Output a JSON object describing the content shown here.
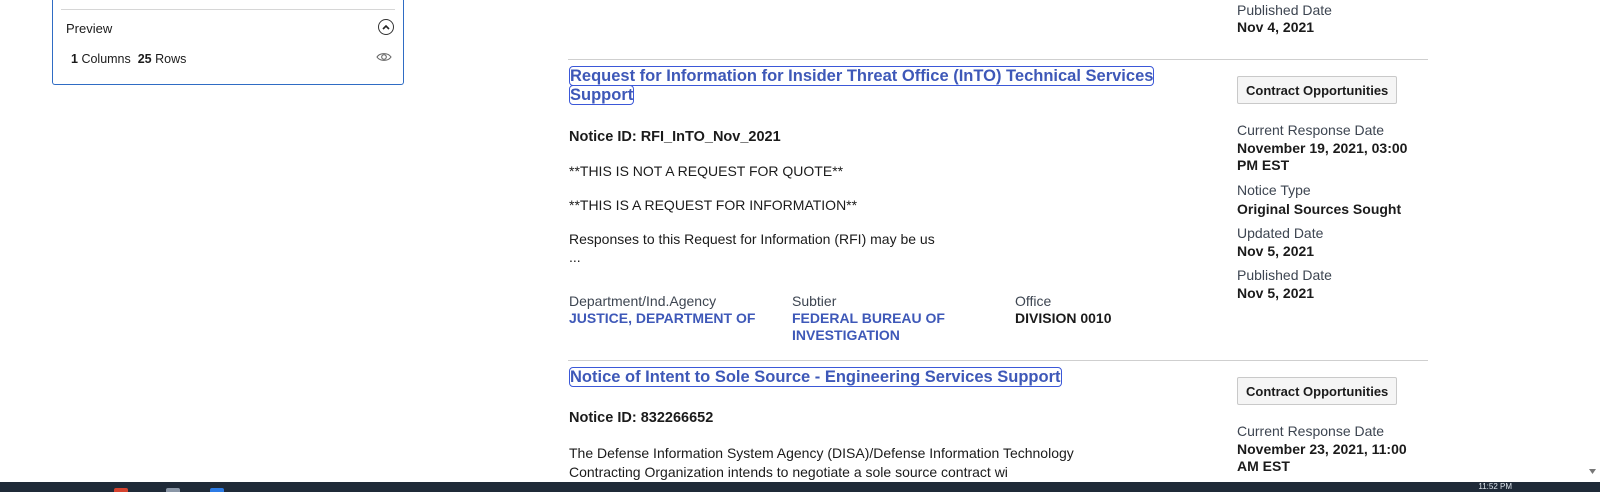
{
  "preview": {
    "title": "Preview",
    "columns_count": "1",
    "columns_label": "Columns",
    "rows_count": "25",
    "rows_label": "Rows"
  },
  "top_meta": {
    "published_label": "Published Date",
    "published_value": "Nov 4, 2021"
  },
  "results": [
    {
      "title_line1": "Request for Information for Insider Threat Office (InTO) Technical Services",
      "title_line2": "Support",
      "notice_id": "Notice ID: RFI_InTO_Nov_2021",
      "desc_lines": [
        "**THIS IS NOT A REQUEST FOR QUOTE**",
        "**THIS IS A REQUEST FOR INFORMATION**",
        "Responses to this Request for Information (RFI) may be us",
        "..."
      ],
      "department_label": "Department/Ind.Agency",
      "department_value": "JUSTICE, DEPARTMENT OF",
      "subtier_label": "Subtier",
      "subtier_line1": "FEDERAL BUREAU OF",
      "subtier_line2": "INVESTIGATION",
      "office_label": "Office",
      "office_value": "DIVISION 0010",
      "tag": "Contract Opportunities",
      "response_label": "Current Response Date",
      "response_line1": "November 19, 2021, 03:00",
      "response_line2": "PM EST",
      "notice_type_label": "Notice Type",
      "notice_type_value": "Original Sources Sought",
      "updated_label": "Updated Date",
      "updated_value": "Nov 5, 2021",
      "published_label": "Published Date",
      "published_value": "Nov 5, 2021"
    },
    {
      "title": "Notice of Intent to Sole Source - Engineering Services Support",
      "notice_id": "Notice ID: 832266652",
      "desc_line1": "The Defense Information System Agency (DISA)/Defense Information Technology",
      "desc_line2": "Contracting Organization intends to negotiate a sole source contract wi",
      "tag": "Contract Opportunities",
      "response_label": "Current Response Date",
      "response_line1": "November 23, 2021, 11:00",
      "response_line2": "AM EST"
    }
  ],
  "taskbar": {
    "clock": "11:52 PM"
  },
  "icons": {
    "collapse": "chevron-up-icon",
    "preview_eye": "eye-icon",
    "scroll": "scroll-down-arrow-icon"
  },
  "colors": {
    "link": "#3e58b8",
    "panel_border": "#2f6cc4",
    "taskbar": "#1f2a38"
  }
}
